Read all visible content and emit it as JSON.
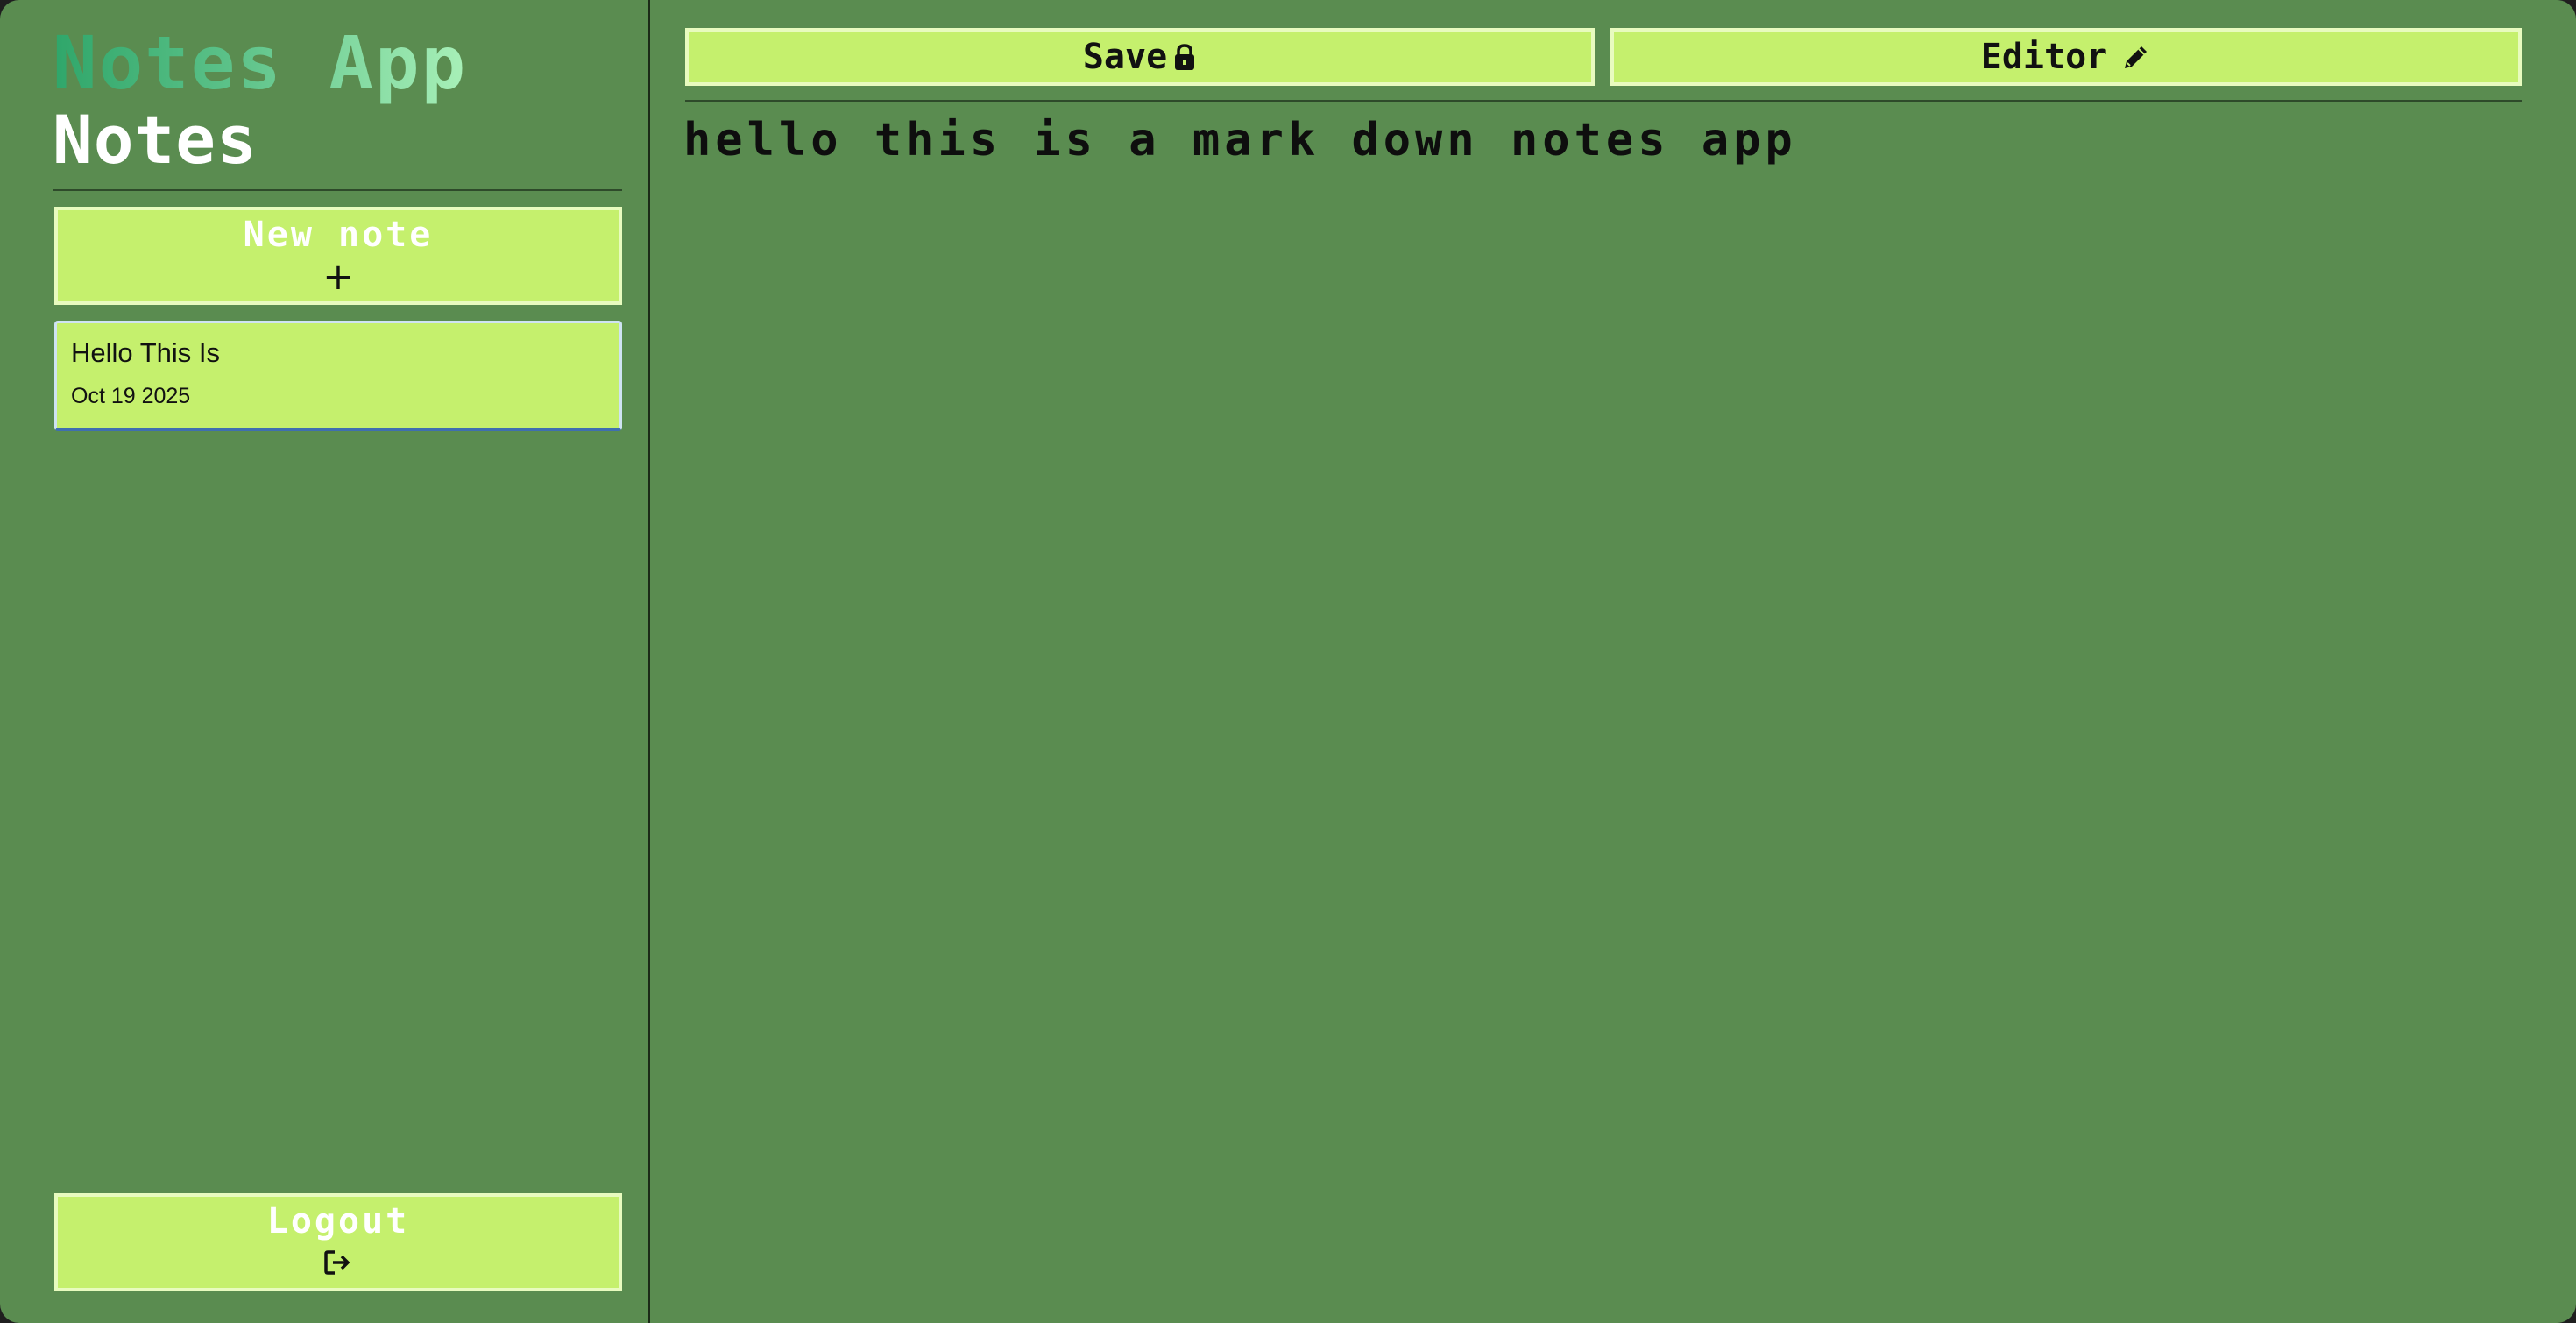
{
  "sidebar": {
    "app_title": "Notes App",
    "section_title": "Notes",
    "new_note": {
      "label": "New note",
      "icon": "plus-icon",
      "icon_glyph": "+"
    },
    "notes": [
      {
        "title": "Hello This Is",
        "date": "Oct 19 2025"
      }
    ],
    "logout": {
      "label": "Logout",
      "icon": "logout-icon"
    }
  },
  "toolbar": {
    "save_label": "Save",
    "save_icon": "lock-icon",
    "editor_label": "Editor",
    "editor_icon": "pencil-icon"
  },
  "editor": {
    "content": "hello this is a mark down notes app"
  },
  "colors": {
    "background": "#5a8c50",
    "button": "#c5f06d",
    "title_gradient_start": "#2fa66a",
    "title_gradient_end": "#a8f0b8"
  }
}
